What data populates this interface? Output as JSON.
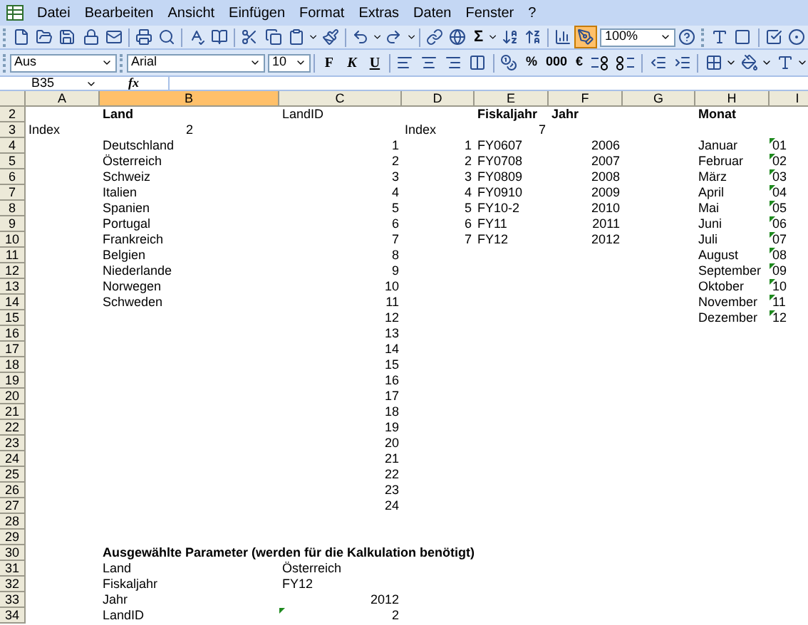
{
  "menu": [
    "Datei",
    "Bearbeiten",
    "Ansicht",
    "Einfügen",
    "Format",
    "Extras",
    "Daten",
    "Fenster",
    "?"
  ],
  "toolbar_standard": {
    "sum": "Σ",
    "zoom": "100%",
    "drawing_button": {
      "pressed": true
    }
  },
  "toolbar_format": {
    "style": "Aus",
    "font": "Arial",
    "size": "10",
    "text_buttons": [
      "F",
      "K",
      "U"
    ],
    "number_buttons": [
      "%",
      "000",
      "€"
    ]
  },
  "formula_bar": {
    "name_box": "B35",
    "function_label": "fx"
  },
  "columns": [
    {
      "label": "A",
      "selected": false
    },
    {
      "label": "B",
      "selected": true
    },
    {
      "label": "C",
      "selected": false
    },
    {
      "label": "D",
      "selected": false
    },
    {
      "label": "E",
      "selected": false
    },
    {
      "label": "F",
      "selected": false
    },
    {
      "label": "G",
      "selected": false
    },
    {
      "label": "H",
      "selected": false
    },
    {
      "label": "I",
      "selected": false
    }
  ],
  "rows": [
    {
      "number": "2",
      "cells": {
        "B": {
          "text": "Land",
          "bold": true,
          "kind": "text"
        },
        "C": {
          "text": "LandID",
          "kind": "text"
        },
        "E": {
          "text": "Fiskaljahr",
          "bold": true,
          "kind": "text"
        },
        "F": {
          "text": "Jahr",
          "bold": true,
          "kind": "text"
        },
        "H": {
          "text": "Monat",
          "bold": true,
          "kind": "text"
        }
      }
    },
    {
      "number": "3",
      "cells": {
        "A": {
          "text": "Index",
          "kind": "text"
        },
        "B": {
          "text": "2",
          "kind": "centered"
        },
        "D": {
          "text": "Index",
          "kind": "text"
        },
        "E": {
          "text": "7",
          "kind": "number"
        }
      }
    },
    {
      "number": "4",
      "cells": {
        "B": {
          "text": "Deutschland",
          "kind": "text"
        },
        "C": {
          "text": "1",
          "kind": "number"
        },
        "D": {
          "text": "1",
          "kind": "number"
        },
        "E": {
          "text": "FY0607",
          "kind": "text"
        },
        "F": {
          "text": "2006",
          "kind": "number"
        },
        "H": {
          "text": "Januar",
          "kind": "text"
        },
        "I": {
          "text": "01",
          "kind": "text",
          "flag": true
        }
      }
    },
    {
      "number": "5",
      "cells": {
        "B": {
          "text": "Österreich",
          "kind": "text"
        },
        "C": {
          "text": "2",
          "kind": "number"
        },
        "D": {
          "text": "2",
          "kind": "number"
        },
        "E": {
          "text": "FY0708",
          "kind": "text"
        },
        "F": {
          "text": "2007",
          "kind": "number"
        },
        "H": {
          "text": "Februar",
          "kind": "text"
        },
        "I": {
          "text": "02",
          "kind": "text",
          "flag": true
        }
      }
    },
    {
      "number": "6",
      "cells": {
        "B": {
          "text": "Schweiz",
          "kind": "text"
        },
        "C": {
          "text": "3",
          "kind": "number"
        },
        "D": {
          "text": "3",
          "kind": "number"
        },
        "E": {
          "text": "FY0809",
          "kind": "text"
        },
        "F": {
          "text": "2008",
          "kind": "number"
        },
        "H": {
          "text": "März",
          "kind": "text"
        },
        "I": {
          "text": "03",
          "kind": "text",
          "flag": true
        }
      }
    },
    {
      "number": "7",
      "cells": {
        "B": {
          "text": "Italien",
          "kind": "text"
        },
        "C": {
          "text": "4",
          "kind": "number"
        },
        "D": {
          "text": "4",
          "kind": "number"
        },
        "E": {
          "text": "FY0910",
          "kind": "text"
        },
        "F": {
          "text": "2009",
          "kind": "number"
        },
        "H": {
          "text": "April",
          "kind": "text"
        },
        "I": {
          "text": "04",
          "kind": "text",
          "flag": true
        }
      }
    },
    {
      "number": "8",
      "cells": {
        "B": {
          "text": "Spanien",
          "kind": "text"
        },
        "C": {
          "text": "5",
          "kind": "number"
        },
        "D": {
          "text": "5",
          "kind": "number"
        },
        "E": {
          "text": "FY10-2",
          "kind": "text"
        },
        "F": {
          "text": "2010",
          "kind": "number"
        },
        "H": {
          "text": "Mai",
          "kind": "text"
        },
        "I": {
          "text": "05",
          "kind": "text",
          "flag": true
        }
      }
    },
    {
      "number": "9",
      "cells": {
        "B": {
          "text": "Portugal",
          "kind": "text"
        },
        "C": {
          "text": "6",
          "kind": "number"
        },
        "D": {
          "text": "6",
          "kind": "number"
        },
        "E": {
          "text": "FY11",
          "kind": "text"
        },
        "F": {
          "text": "2011",
          "kind": "number"
        },
        "H": {
          "text": "Juni",
          "kind": "text"
        },
        "I": {
          "text": "06",
          "kind": "text",
          "flag": true
        }
      }
    },
    {
      "number": "10",
      "cells": {
        "B": {
          "text": "Frankreich",
          "kind": "text"
        },
        "C": {
          "text": "7",
          "kind": "number"
        },
        "D": {
          "text": "7",
          "kind": "number"
        },
        "E": {
          "text": "FY12",
          "kind": "text"
        },
        "F": {
          "text": "2012",
          "kind": "number"
        },
        "H": {
          "text": "Juli",
          "kind": "text"
        },
        "I": {
          "text": "07",
          "kind": "text",
          "flag": true
        }
      }
    },
    {
      "number": "11",
      "cells": {
        "B": {
          "text": "Belgien",
          "kind": "text"
        },
        "C": {
          "text": "8",
          "kind": "number"
        },
        "H": {
          "text": "August",
          "kind": "text"
        },
        "I": {
          "text": "08",
          "kind": "text",
          "flag": true
        }
      }
    },
    {
      "number": "12",
      "cells": {
        "B": {
          "text": "Niederlande",
          "kind": "text"
        },
        "C": {
          "text": "9",
          "kind": "number"
        },
        "H": {
          "text": "September",
          "kind": "text"
        },
        "I": {
          "text": "09",
          "kind": "text",
          "flag": true
        }
      }
    },
    {
      "number": "13",
      "cells": {
        "B": {
          "text": "Norwegen",
          "kind": "text"
        },
        "C": {
          "text": "10",
          "kind": "number"
        },
        "H": {
          "text": "Oktober",
          "kind": "text"
        },
        "I": {
          "text": "10",
          "kind": "text",
          "flag": true
        }
      }
    },
    {
      "number": "14",
      "cells": {
        "B": {
          "text": "Schweden",
          "kind": "text"
        },
        "C": {
          "text": "11",
          "kind": "number"
        },
        "H": {
          "text": "November",
          "kind": "text"
        },
        "I": {
          "text": "11",
          "kind": "text",
          "flag": true
        }
      }
    },
    {
      "number": "15",
      "cells": {
        "C": {
          "text": "12",
          "kind": "number"
        },
        "H": {
          "text": "Dezember",
          "kind": "text"
        },
        "I": {
          "text": "12",
          "kind": "text",
          "flag": true
        }
      }
    },
    {
      "number": "16",
      "cells": {
        "C": {
          "text": "13",
          "kind": "number"
        }
      }
    },
    {
      "number": "17",
      "cells": {
        "C": {
          "text": "14",
          "kind": "number"
        }
      }
    },
    {
      "number": "18",
      "cells": {
        "C": {
          "text": "15",
          "kind": "number"
        }
      }
    },
    {
      "number": "19",
      "cells": {
        "C": {
          "text": "16",
          "kind": "number"
        }
      }
    },
    {
      "number": "20",
      "cells": {
        "C": {
          "text": "17",
          "kind": "number"
        }
      }
    },
    {
      "number": "21",
      "cells": {
        "C": {
          "text": "18",
          "kind": "number"
        }
      }
    },
    {
      "number": "22",
      "cells": {
        "C": {
          "text": "19",
          "kind": "number"
        }
      }
    },
    {
      "number": "23",
      "cells": {
        "C": {
          "text": "20",
          "kind": "number"
        }
      }
    },
    {
      "number": "24",
      "cells": {
        "C": {
          "text": "21",
          "kind": "number"
        }
      }
    },
    {
      "number": "25",
      "cells": {
        "C": {
          "text": "22",
          "kind": "number"
        }
      }
    },
    {
      "number": "26",
      "cells": {
        "C": {
          "text": "23",
          "kind": "number"
        }
      }
    },
    {
      "number": "27",
      "cells": {
        "C": {
          "text": "24",
          "kind": "number"
        }
      }
    },
    {
      "number": "28",
      "cells": {}
    },
    {
      "number": "29",
      "cells": {}
    },
    {
      "number": "30",
      "cells": {
        "B": {
          "text": "Ausgewählte Parameter (werden für die Kalkulation benötigt)",
          "bold": true,
          "kind": "text"
        }
      }
    },
    {
      "number": "31",
      "cells": {
        "B": {
          "text": "Land",
          "kind": "text"
        },
        "C": {
          "text": "Österreich",
          "kind": "text"
        }
      }
    },
    {
      "number": "32",
      "cells": {
        "B": {
          "text": "Fiskaljahr",
          "kind": "text"
        },
        "C": {
          "text": "FY12",
          "kind": "text"
        }
      }
    },
    {
      "number": "33",
      "cells": {
        "B": {
          "text": "Jahr",
          "kind": "text"
        },
        "C": {
          "text": "2012",
          "kind": "number"
        }
      }
    },
    {
      "number": "34",
      "cells": {
        "B": {
          "text": "LandID",
          "kind": "text"
        },
        "C": {
          "text": "2",
          "kind": "number",
          "flag": true
        }
      }
    }
  ]
}
